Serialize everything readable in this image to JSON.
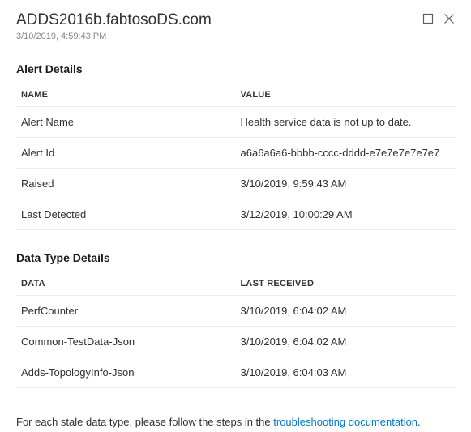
{
  "header": {
    "title": "ADDS2016b.fabtosoDS.com",
    "timestamp": "3/10/2019, 4:59:43 PM"
  },
  "alertDetails": {
    "title": "Alert Details",
    "columns": {
      "name": "NAME",
      "value": "VALUE"
    },
    "rows": [
      {
        "name": "Alert Name",
        "value": "Health service data is not up to date."
      },
      {
        "name": "Alert Id",
        "value": "a6a6a6a6-bbbb-cccc-dddd-e7e7e7e7e7e7"
      },
      {
        "name": "Raised",
        "value": "3/10/2019, 9:59:43 AM"
      },
      {
        "name": "Last Detected",
        "value": "3/12/2019, 10:00:29 AM"
      }
    ]
  },
  "dataTypeDetails": {
    "title": "Data Type Details",
    "columns": {
      "data": "DATA",
      "lastReceived": "LAST RECEIVED"
    },
    "rows": [
      {
        "data": "PerfCounter",
        "lastReceived": "3/10/2019, 6:04:02 AM"
      },
      {
        "data": "Common-TestData-Json",
        "lastReceived": "3/10/2019, 6:04:02 AM"
      },
      {
        "data": "Adds-TopologyInfo-Json",
        "lastReceived": "3/10/2019, 6:04:03 AM"
      }
    ]
  },
  "footer": {
    "prefix": "For each stale data type, please follow the steps in the ",
    "linkText": "troubleshooting documentation",
    "suffix": "."
  }
}
